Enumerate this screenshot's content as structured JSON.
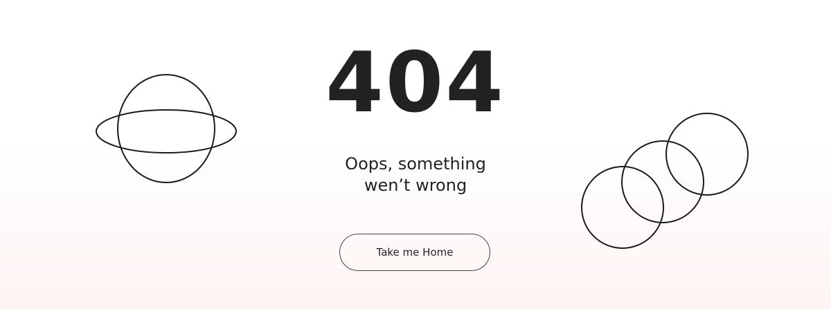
{
  "error": {
    "code": "404",
    "message_line1": "Oops, something",
    "message_line2": "wen’t wrong"
  },
  "actions": {
    "home_button_label": "Take me Home"
  },
  "decorations": {
    "left_icon": "planet-icon",
    "right_icon": "interlocking-circles-icon"
  },
  "colors": {
    "text": "#222222",
    "background_top": "#ffffff",
    "background_bottom": "#fdf4f3",
    "line": "#1a1a1a"
  }
}
